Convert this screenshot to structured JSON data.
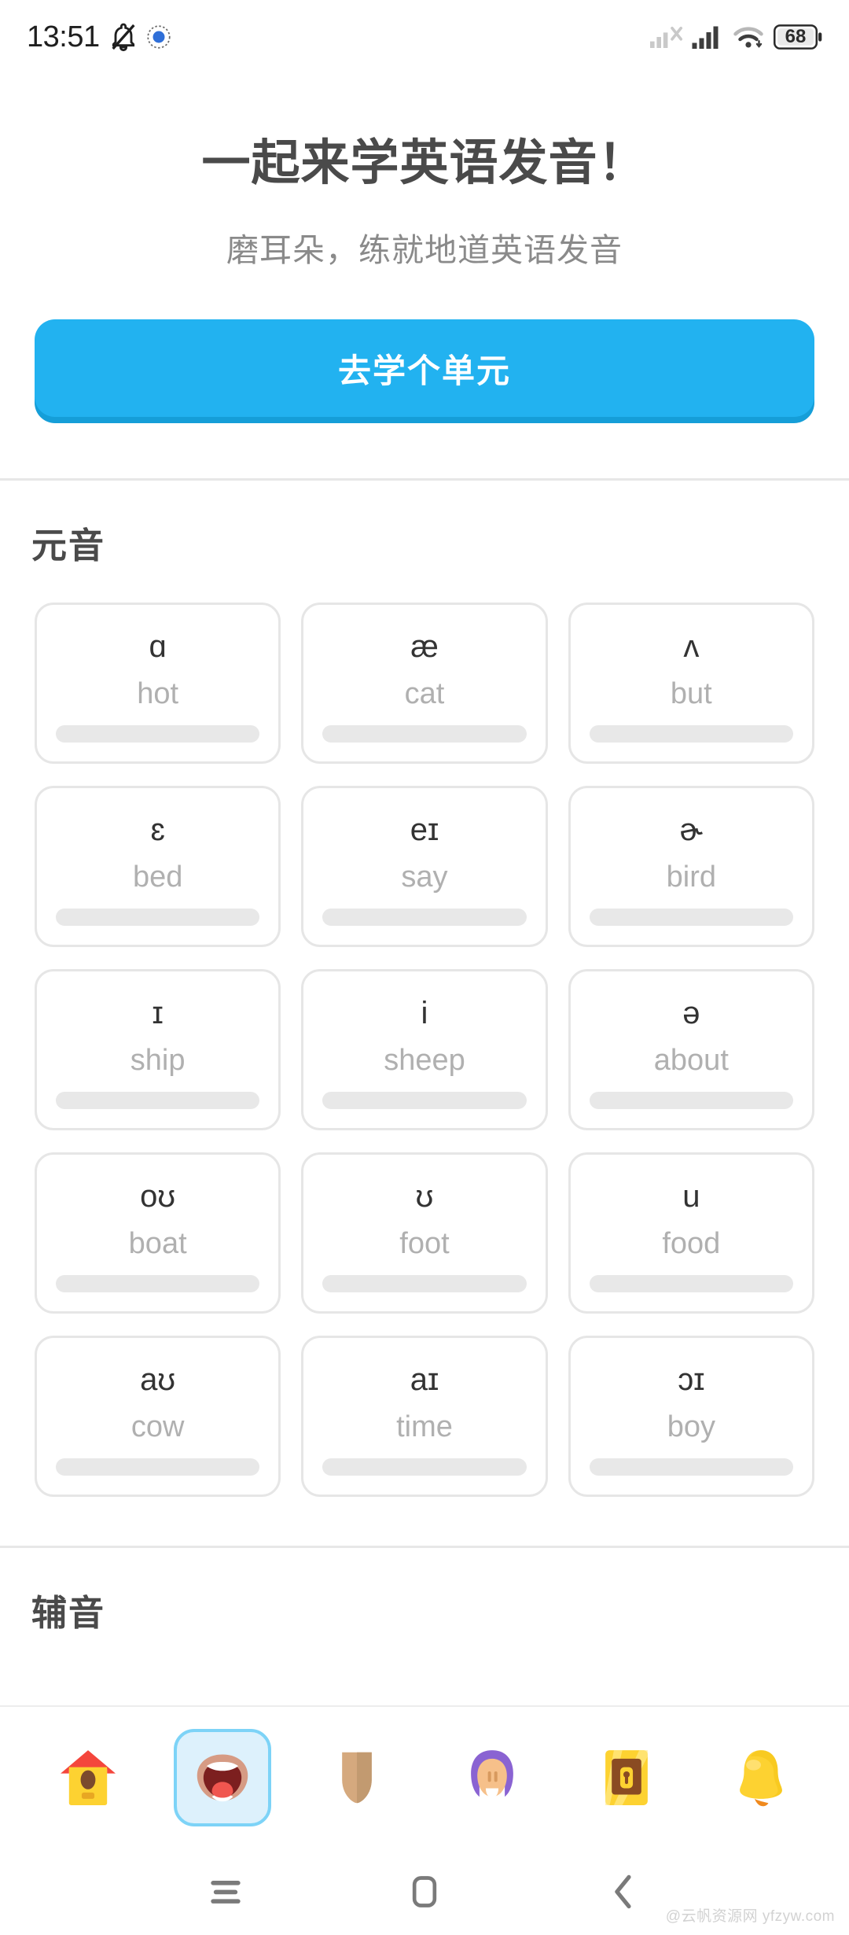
{
  "status_bar": {
    "time": "13:51",
    "icons_left": [
      "bell-slash-icon",
      "app-blue-icon"
    ],
    "icons_right": [
      "signal-no-sim-icon",
      "signal-bars-icon",
      "wifi-icon",
      "battery-icon"
    ],
    "battery_level": "68"
  },
  "hero": {
    "title": "一起来学英语发音！",
    "subtitle": "磨耳朵，练就地道英语发音",
    "cta_label": "去学个单元",
    "cta_color": "#22b2f0",
    "cta_shadow_color": "#159ed8"
  },
  "sections": [
    {
      "id": "vowels",
      "title": "元音",
      "cards": [
        {
          "ipa": "ɑ",
          "word": "hot",
          "progress": 0
        },
        {
          "ipa": "æ",
          "word": "cat",
          "progress": 0
        },
        {
          "ipa": "ʌ",
          "word": "but",
          "progress": 0
        },
        {
          "ipa": "ɛ",
          "word": "bed",
          "progress": 0
        },
        {
          "ipa": "eɪ",
          "word": "say",
          "progress": 0
        },
        {
          "ipa": "ɚ",
          "word": "bird",
          "progress": 0
        },
        {
          "ipa": "ɪ",
          "word": "ship",
          "progress": 0
        },
        {
          "ipa": "i",
          "word": "sheep",
          "progress": 0
        },
        {
          "ipa": "ə",
          "word": "about",
          "progress": 0
        },
        {
          "ipa": "oʊ",
          "word": "boat",
          "progress": 0
        },
        {
          "ipa": "ʊ",
          "word": "foot",
          "progress": 0
        },
        {
          "ipa": "u",
          "word": "food",
          "progress": 0
        },
        {
          "ipa": "aʊ",
          "word": "cow",
          "progress": 0
        },
        {
          "ipa": "aɪ",
          "word": "time",
          "progress": 0
        },
        {
          "ipa": "ɔɪ",
          "word": "boy",
          "progress": 0
        }
      ]
    },
    {
      "id": "consonants",
      "title": "辅音",
      "cards": []
    }
  ],
  "tab_bar": {
    "selected_index": 1,
    "selected_bg": "#ddf1fc",
    "selected_border": "#7dd3f7",
    "tabs": [
      {
        "icon": "house-icon"
      },
      {
        "icon": "mouth-icon"
      },
      {
        "icon": "shield-icon"
      },
      {
        "icon": "person-icon"
      },
      {
        "icon": "treasure-chest-icon"
      },
      {
        "icon": "bell-icon"
      }
    ]
  },
  "nav_bar": {
    "buttons": [
      {
        "icon": "menu-icon"
      },
      {
        "icon": "home-square-icon"
      },
      {
        "icon": "back-chevron-icon"
      }
    ]
  },
  "watermark": "@云帆资源网 yfzyw.com"
}
